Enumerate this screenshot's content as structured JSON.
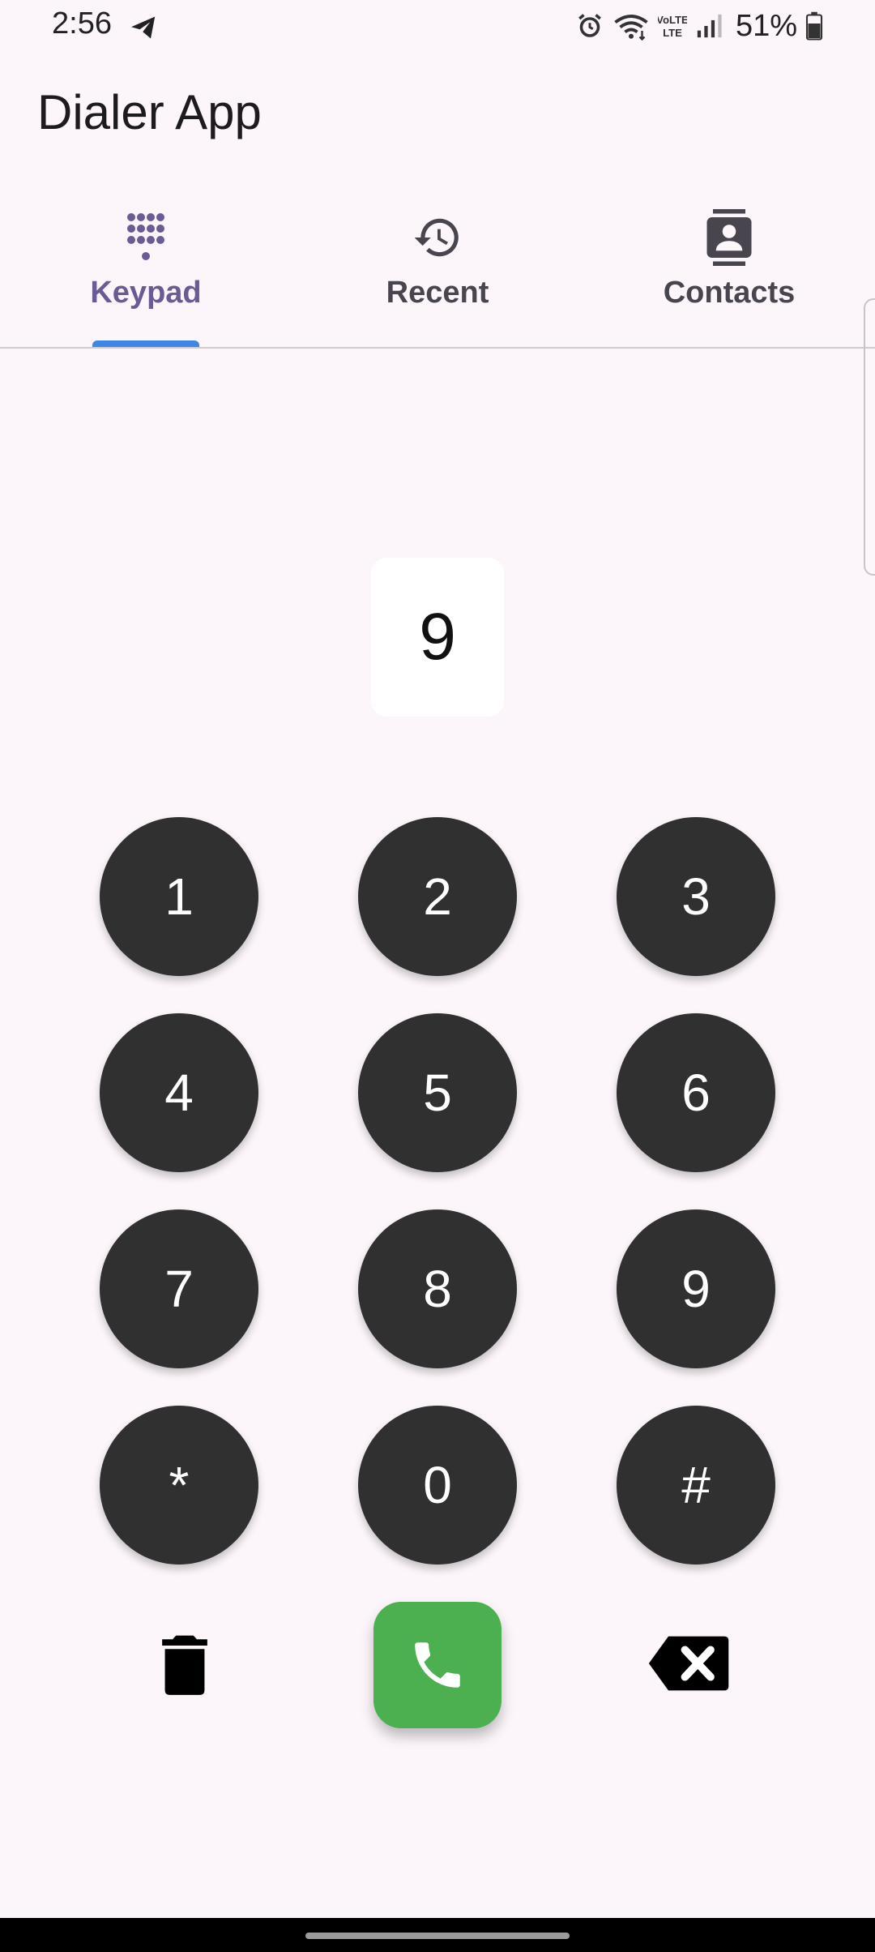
{
  "status_bar": {
    "time": "2:56",
    "battery_percent": "51%",
    "icons": [
      "telegram-icon",
      "alarm-icon",
      "wifi-icon",
      "volte-icon",
      "signal-icon",
      "battery-icon"
    ]
  },
  "app_bar": {
    "title": "Dialer App"
  },
  "tabs": [
    {
      "label": "Keypad",
      "icon": "dialpad-icon",
      "active": true
    },
    {
      "label": "Recent",
      "icon": "history-icon",
      "active": false
    },
    {
      "label": "Contacts",
      "icon": "contacts-icon",
      "active": false
    }
  ],
  "display": {
    "value": "9"
  },
  "keypad": {
    "keys": [
      "1",
      "2",
      "3",
      "4",
      "5",
      "6",
      "7",
      "8",
      "9",
      "*",
      "0",
      "#"
    ]
  },
  "actions": {
    "delete_icon": "trash-icon",
    "call_icon": "phone-icon",
    "backspace_icon": "backspace-icon"
  },
  "colors": {
    "background": "#fcf6fb",
    "key_fill": "#303030",
    "call_green": "#4cb050",
    "tab_indicator": "#3f87e6",
    "tab_active_label": "#6b5b95"
  }
}
